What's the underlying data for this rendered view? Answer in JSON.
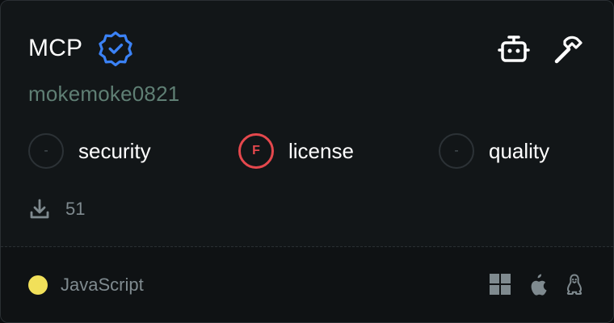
{
  "card": {
    "title": "MCP",
    "author": "mokemoke0821",
    "verified_icon": "verified-badge-icon",
    "top_icons": [
      "robot-icon",
      "hammer-icon"
    ],
    "metrics": [
      {
        "id": "security",
        "label": "security",
        "grade": "-",
        "status": "none"
      },
      {
        "id": "license",
        "label": "license",
        "grade": "F",
        "status": "fail"
      },
      {
        "id": "quality",
        "label": "quality",
        "grade": "-",
        "status": "none"
      }
    ],
    "downloads": {
      "icon": "download-icon",
      "count": "51"
    },
    "language": {
      "name": "JavaScript",
      "color": "#f1e05a"
    },
    "platforms": [
      "windows-icon",
      "apple-icon",
      "linux-icon"
    ]
  },
  "colors": {
    "verified": "#3b82f6",
    "fail": "#e5484d",
    "author": "#5f7f74",
    "muted": "#7f8a8f"
  }
}
